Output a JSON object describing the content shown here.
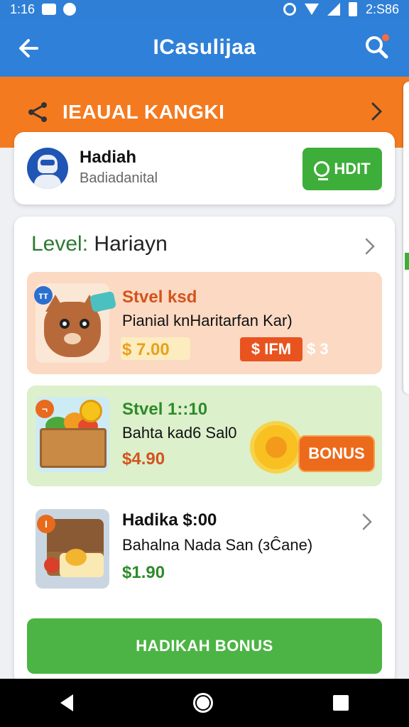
{
  "status_bar": {
    "time": "1:16",
    "right_text": "2:S86"
  },
  "app_bar": {
    "title": "ICasulijaa",
    "back_icon": "arrow-left-icon",
    "search_icon": "search-icon"
  },
  "banner": {
    "text": "IEAUAL KANGKI",
    "icon": "share-icon"
  },
  "profile": {
    "name": "Hadiah",
    "subtitle": "Badiadanital",
    "button_label": "HDIT"
  },
  "main": {
    "level_label": "Level:",
    "level_value": "Hariayn",
    "offers": [
      {
        "badge": "тт",
        "title": "Stvel ksd",
        "desc": "Pianial knHaritarfan Kar)",
        "price": "$ 7.00",
        "tag": "$ IFM",
        "tag2": "$ 3"
      },
      {
        "badge": "¬",
        "title": "Stvel 1::10",
        "desc": "Bahta kad6 Sal0",
        "price": "$4.90",
        "tag": "BONUS"
      },
      {
        "badge": "I",
        "title": "Hadika $:00",
        "desc": "Bahalna Nada San (зĈane)",
        "price": "$1.90"
      }
    ],
    "cta_label": "HADIKAH BONUS"
  },
  "colors": {
    "app_bar": "#2f80d8",
    "banner": "#f47a20",
    "green": "#3eae3a",
    "orange_tag": "#e9531f"
  }
}
